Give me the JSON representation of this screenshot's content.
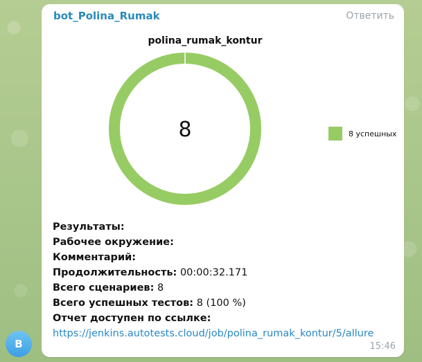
{
  "sender_name": "bot_Polina_Rumak",
  "reply_label": "Ответить",
  "avatar_letter": "B",
  "message_time": "15:46",
  "chart_data": {
    "type": "pie",
    "donut": true,
    "title": "polina_rumak_kontur",
    "center_label": "8",
    "categories": [
      "8 успешных"
    ],
    "values": [
      8
    ],
    "colors": [
      "#97cc64"
    ],
    "legend_position": "right"
  },
  "report": {
    "results_label": "Результаты:",
    "environment_label": "Рабочее окружение:",
    "comment_label": "Комментарий:",
    "duration_label": "Продолжительность:",
    "duration_value": "00:00:32.171",
    "scenarios_label": "Всего сценариев:",
    "scenarios_value": "8",
    "passed_label": "Всего успешных тестов:",
    "passed_value": "8 (100 %)",
    "link_label": "Отчет доступен по ссылке:",
    "link_url": "https://jenkins.autotests.cloud/job/polina_rumak_kontur/5/allure"
  }
}
